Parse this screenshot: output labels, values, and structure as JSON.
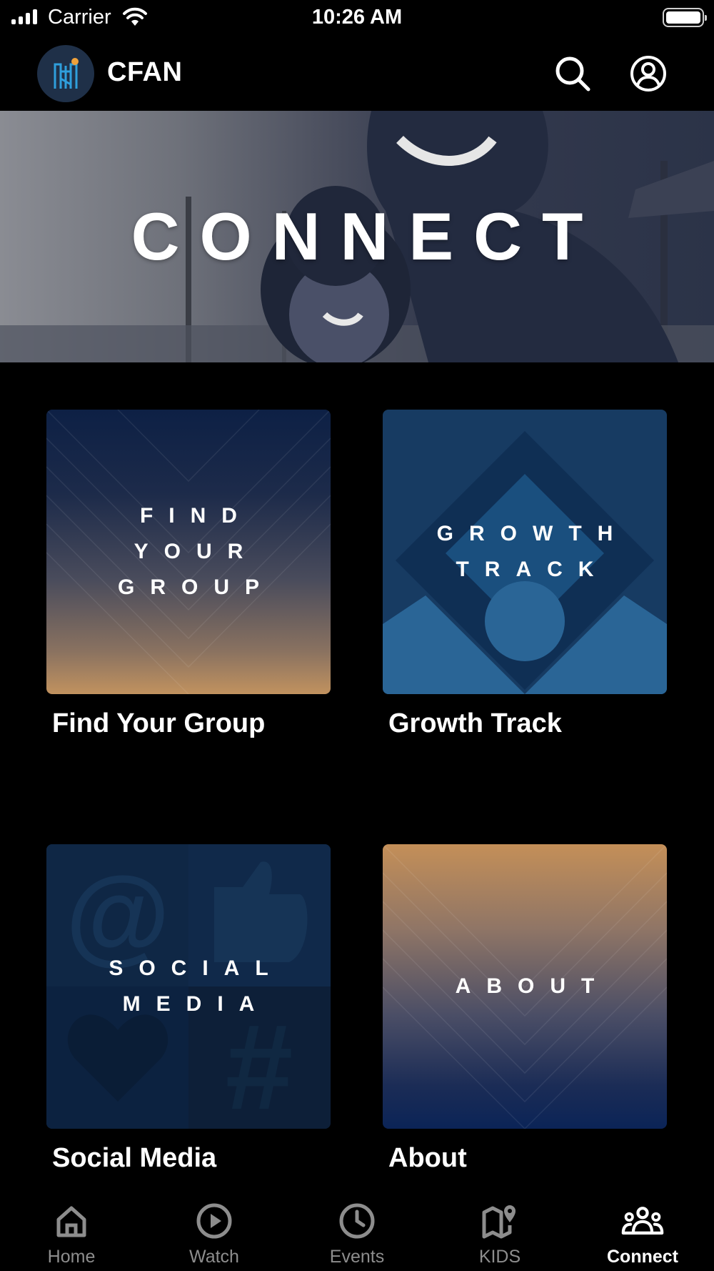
{
  "status_bar": {
    "carrier": "Carrier",
    "time": "10:26 AM"
  },
  "header": {
    "title": "CFAN",
    "logo_icon": "cfan-logo-icon",
    "search_icon": "search-icon",
    "profile_icon": "user-circle-icon"
  },
  "hero": {
    "title": "CONNECT"
  },
  "cards": [
    {
      "tile_text": "FIND\nYOUR\nGROUP",
      "label": "Find Your Group"
    },
    {
      "tile_text": "GROWTH\nTRACK",
      "label": "Growth Track"
    },
    {
      "tile_text": "SOCIAL\nMEDIA",
      "label": "Social Media"
    },
    {
      "tile_text": "ABOUT",
      "label": "About"
    }
  ],
  "tabs": [
    {
      "label": "Home",
      "icon": "home-icon",
      "active": false
    },
    {
      "label": "Watch",
      "icon": "play-circle-icon",
      "active": false
    },
    {
      "label": "Events",
      "icon": "clock-icon",
      "active": false
    },
    {
      "label": "KIDS",
      "icon": "map-pin-icon",
      "active": false
    },
    {
      "label": "Connect",
      "icon": "people-icon",
      "active": true
    }
  ],
  "colors": {
    "background": "#000000",
    "inactive_tab": "#8d8d8d",
    "active_tab": "#ffffff",
    "logo_accent": "#2f9fdc"
  }
}
